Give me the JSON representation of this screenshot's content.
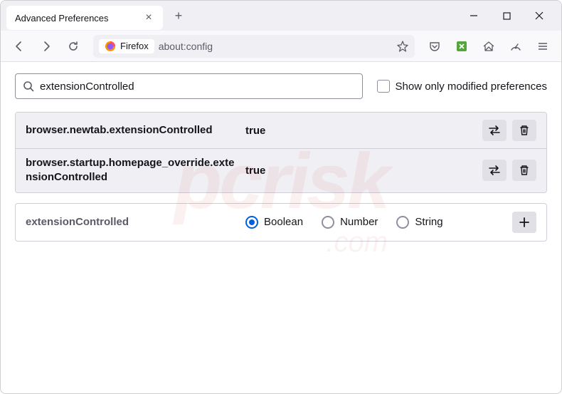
{
  "window": {
    "tab_title": "Advanced Preferences"
  },
  "urlbar": {
    "identity_label": "Firefox",
    "url": "about:config"
  },
  "search": {
    "value": "extensionControlled",
    "checkbox_label": "Show only modified preferences"
  },
  "prefs": [
    {
      "name": "browser.newtab.extensionControlled",
      "value": "true"
    },
    {
      "name": "browser.startup.homepage_override.extensionControlled",
      "value": "true"
    }
  ],
  "create": {
    "name": "extensionControlled",
    "types": [
      "Boolean",
      "Number",
      "String"
    ],
    "selected": "Boolean"
  },
  "watermark": {
    "main": "pcrisk",
    "sub": ".com"
  }
}
